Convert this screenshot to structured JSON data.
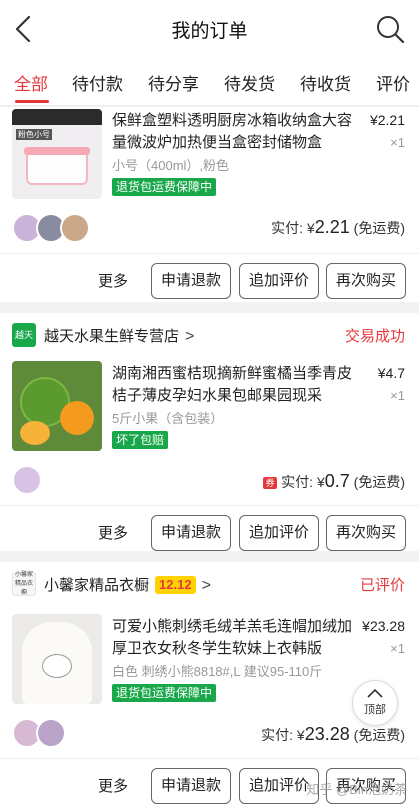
{
  "header": {
    "title": "我的订单",
    "back_icon": "back-arrow-icon",
    "search_icon": "search-icon"
  },
  "tabs": [
    {
      "label": "全部",
      "active": true
    },
    {
      "label": "待付款"
    },
    {
      "label": "待分享"
    },
    {
      "label": "待发货"
    },
    {
      "label": "待收货"
    },
    {
      "label": "评价"
    }
  ],
  "orders": [
    {
      "thumb_text": "粉色小号",
      "product_title": "保鲜盒塑料透明厨房冰箱收纳盒大容量微波炉加热便当盒密封储物盒",
      "price": "¥2.21",
      "qty": "×1",
      "spec": "小号（400ml）,粉色",
      "tag": "退货包运费保障中",
      "paid_label": "实付: ¥",
      "paid_amount": "2.21",
      "shipping": "(免运费)",
      "actions": {
        "more": "更多",
        "refund": "申请退款",
        "review": "追加评价",
        "rebuy": "再次购买"
      }
    },
    {
      "shop_logo": "越天",
      "shop_name": "越天水果生鲜专营店",
      "status": "交易成功",
      "product_title": "湖南湘西蜜桔现摘新鲜蜜橘当季青皮桔子薄皮孕妇水果包邮果园现采",
      "price": "¥4.7",
      "qty": "×1",
      "spec": "5斤小果（含包装）",
      "tag": "坏了包赔",
      "coupon_icon": "券",
      "paid_label": "实付: ¥",
      "paid_amount": "0.7",
      "shipping": "(免运费)",
      "actions": {
        "more": "更多",
        "refund": "申请退款",
        "review": "追加评价",
        "rebuy": "再次购买"
      }
    },
    {
      "shop_logo": "小馨家精品衣橱",
      "shop_name": "小馨家精品衣橱",
      "promo_badge": "12.12",
      "status": "已评价",
      "product_title": "可爱小熊刺绣毛绒羊羔毛连帽加绒加厚卫衣女秋冬学生软妹上衣韩版",
      "price": "¥23.28",
      "qty": "×1",
      "spec": "白色 刺绣小熊8818#,L 建议95-110斤",
      "tag": "退货包运费保障中",
      "paid_label": "实付: ¥",
      "paid_amount": "23.28",
      "shipping": "(免运费)",
      "actions": {
        "more": "更多",
        "refund": "申请退款",
        "review": "追加评价",
        "rebuy": "再次购买"
      }
    }
  ],
  "to_top": {
    "label": "顶部"
  },
  "watermark": "知乎 @Bin泡奶茶",
  "colors": {
    "accent": "#e4393c",
    "tag_green": "#18a84a",
    "promo_yellow": "#ffd200"
  }
}
